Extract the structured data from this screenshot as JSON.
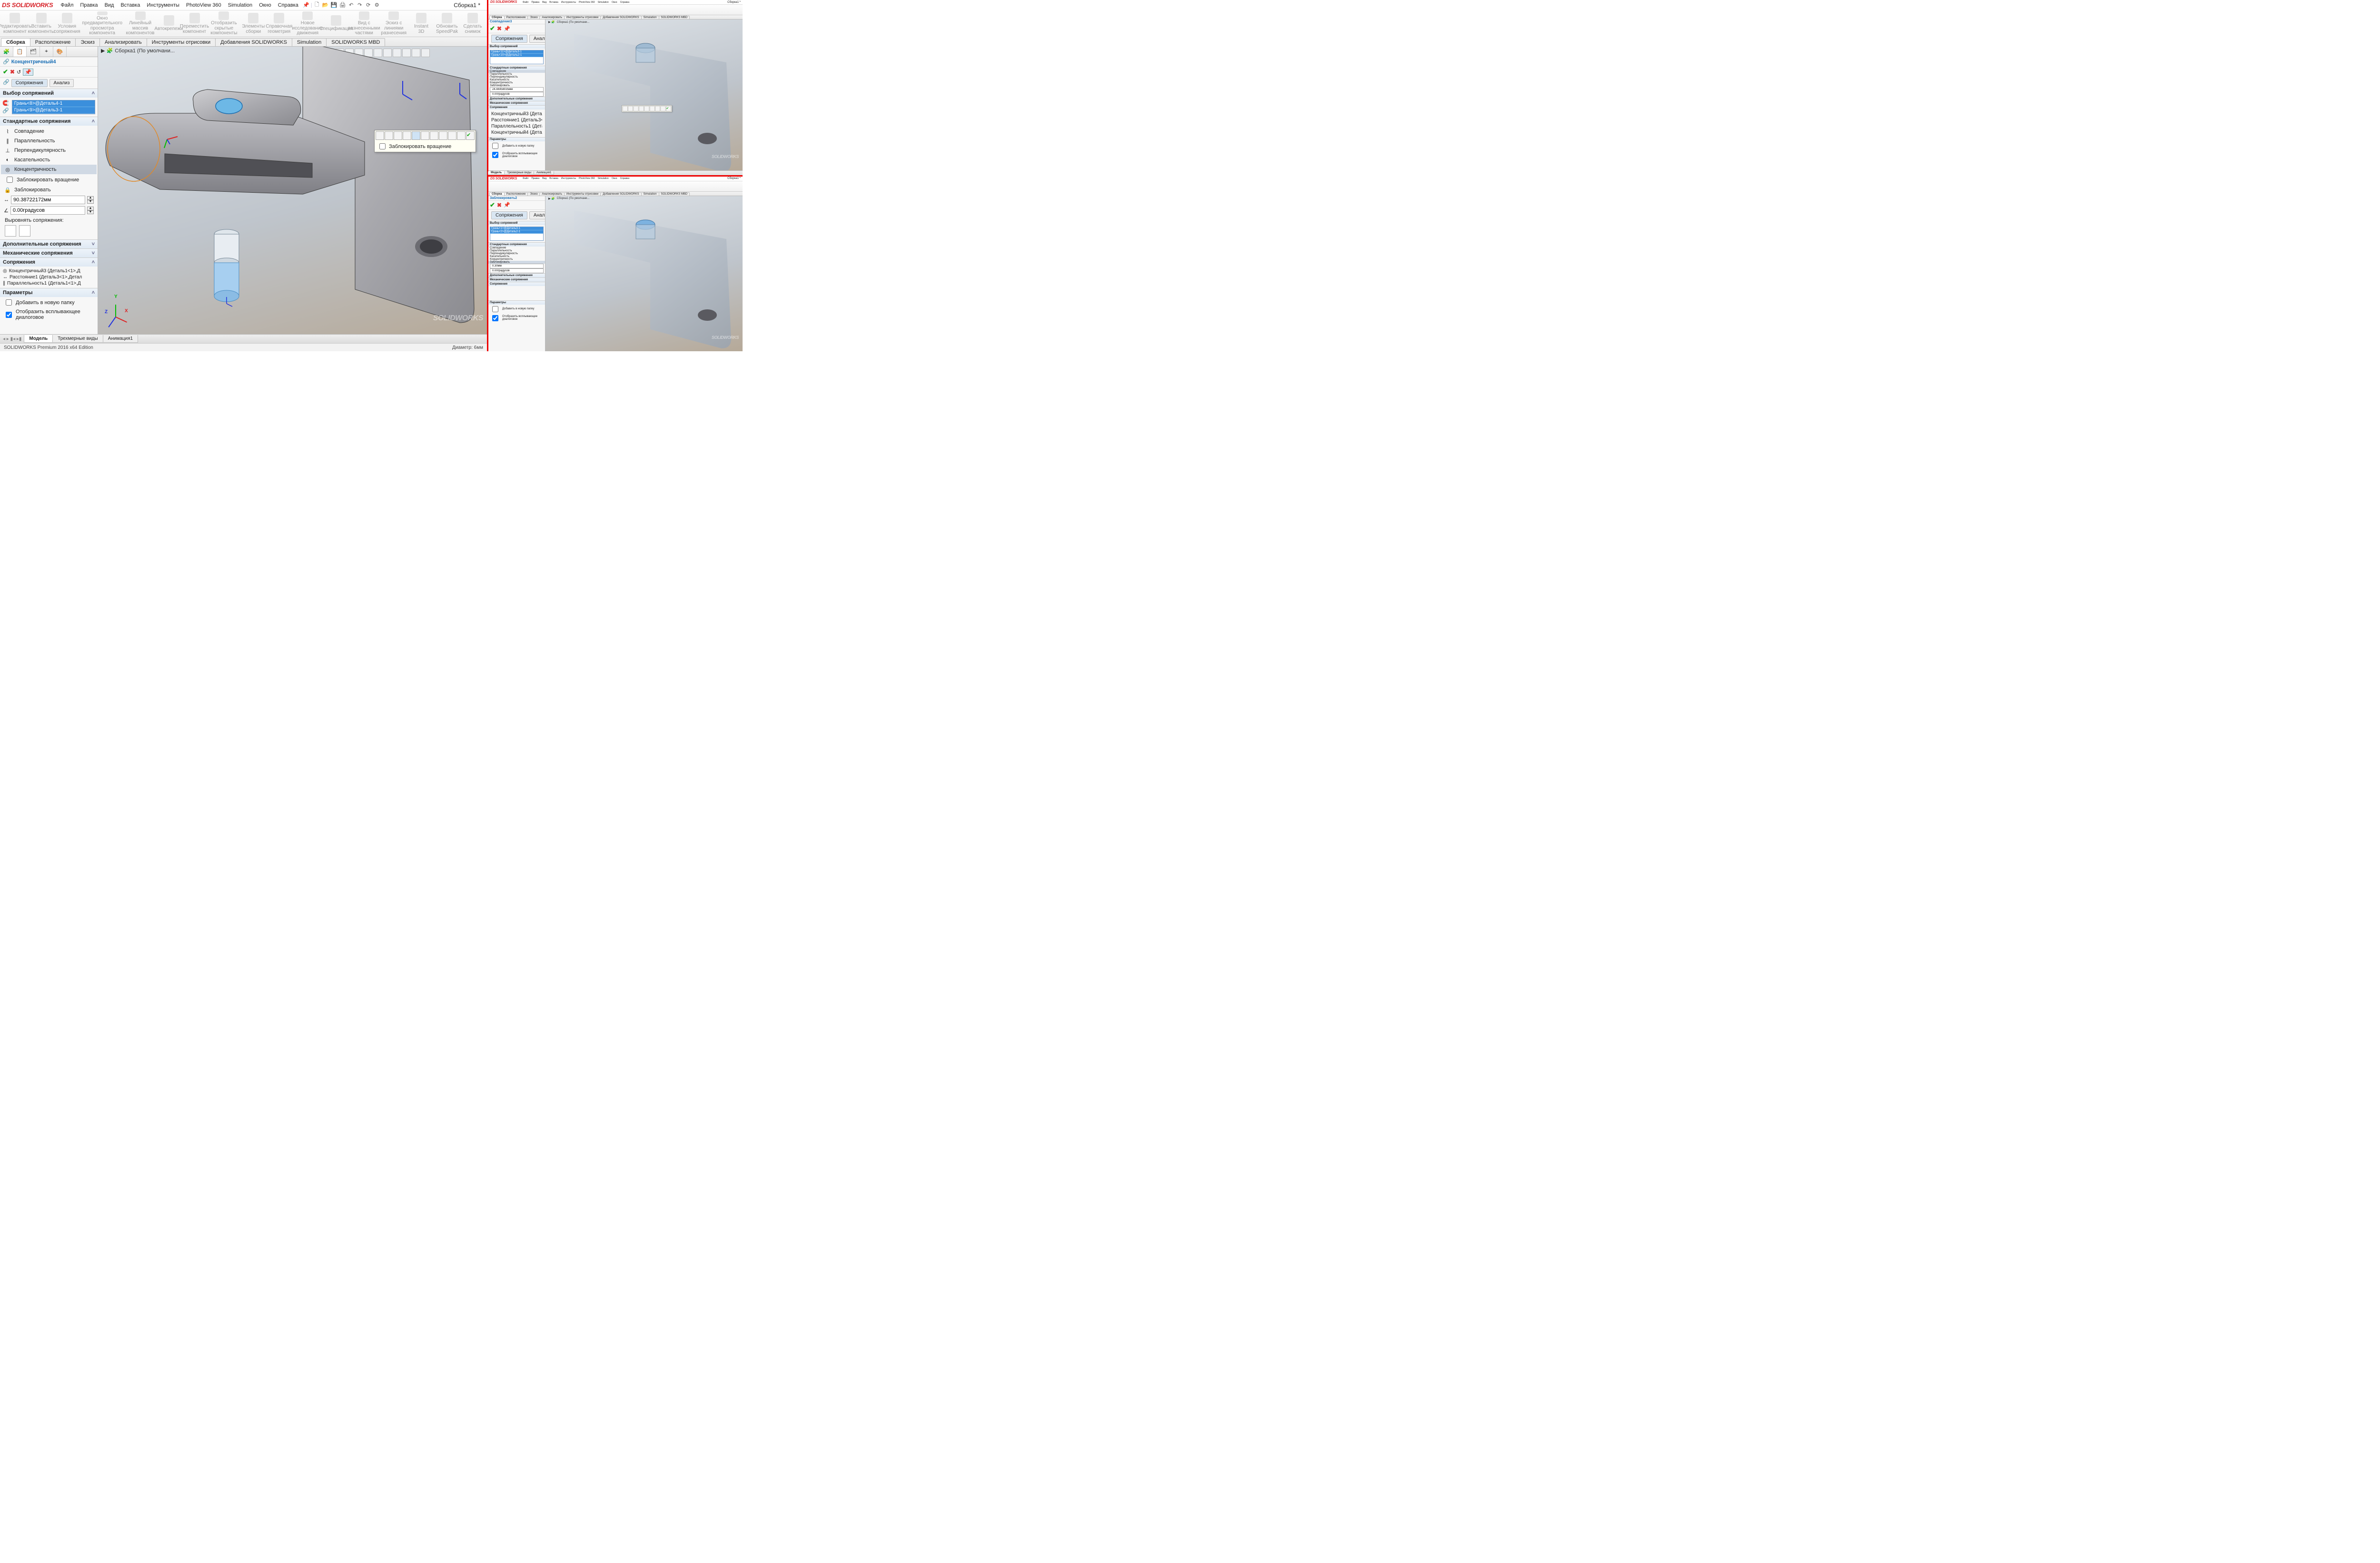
{
  "app": {
    "logo_prefix": "DS",
    "logo_brand": "SOLIDWORKS",
    "document": "Сборка1 *"
  },
  "menu": [
    "Файл",
    "Правка",
    "Вид",
    "Вставка",
    "Инструменты",
    "PhotoView 360",
    "Simulation",
    "Окно",
    "Справка"
  ],
  "ribbon": [
    "Редактировать компонент",
    "Вставить компоненты",
    "Условия сопряжения",
    "Окно предварительного просмотра компонента",
    "Линейный массив компонентов",
    "Автокрепежи",
    "Переместить компонент",
    "Отобразить скрытые компоненты",
    "Элементы сборки",
    "Справочная геометрия",
    "Новое исследование движения",
    "Спецификация",
    "Вид с разнесенными частями",
    "Эскиз с линиями разнесения",
    "Instant 3D",
    "Обновить SpeedPak",
    "Сделать снимок"
  ],
  "tabs": [
    "Сборка",
    "Расположение",
    "Эскиз",
    "Анализировать",
    "Инструменты отрисовки",
    "Добавления SOLIDWORKS",
    "Simulation",
    "SOLIDWORKS MBD"
  ],
  "active_tab": 0,
  "breadcrumb": "Сборка1  (По умолчани...",
  "panel": {
    "title": "Концентричный4",
    "subtabs": [
      "Сопряжения",
      "Анализ"
    ],
    "active_subtab": 0,
    "sections": {
      "selection": "Выбор сопряжений",
      "standard": "Стандартные сопряжения",
      "advanced": "Дополнительные сопряжения",
      "mechanical": "Механические сопряжения",
      "mates": "Сопряжения",
      "options": "Параметры",
      "align": "Выровнять сопряжения:"
    },
    "sel_items": [
      "Грань<8>@Деталь4-1",
      "Грань<9>@Деталь3-1"
    ],
    "std_mates": [
      "Совпадение",
      "Параллельность",
      "Перпендикулярность",
      "Касательность",
      "Концентричность"
    ],
    "selected_std": 4,
    "lock_rotation": "Заблокировать вращение",
    "lock": "Заблокировать",
    "distance": "90.38722172мм",
    "angle": "0.00градусов",
    "mate_items": [
      "Концентричный3 (Деталь1<1>,Д",
      "Расстояние1 (Деталь3<1>,Детал",
      "Параллельность1 (Деталь1<1>,Д"
    ],
    "opt_newfolder": "Добавить в новую папку",
    "opt_popup": "Отобразить всплывающее диалоговое"
  },
  "popup_lock": "Заблокировать вращение",
  "bottom_tabs": [
    "Модель",
    "Трехмерные виды",
    "Анимация1"
  ],
  "active_bottom": 0,
  "status_left": "SOLIDWORKS Premium 2016 x64 Edition",
  "status_right": "Диаметр: 6мм",
  "thumb_top": {
    "title": "Совпадение3",
    "sel": [
      "Грань<11>@Деталь3-1",
      "Грань<10>@Деталь2-1"
    ],
    "distance": "24.44458035мм",
    "angle": "0.00градусов",
    "mates": [
      "Концентричный3 (Деталь1<1>,Дет...",
      "Расстояние1 (Деталь3<1>,Деталь3<...",
      "Параллельность1 (Деталь1<1>,Де...",
      "Концентричный4 (Деталь4<1>,Дет..."
    ],
    "btabs": [
      "Модель",
      "Трехмерные виды",
      "Анимация1"
    ]
  },
  "thumb_bottom": {
    "title": "Заблокировать2",
    "sel": [
      "Грань<1>@Деталь3-1",
      "Грань<2>@Деталь2-1"
    ],
    "distance": "0.30мм",
    "angle": "0.00градусов"
  }
}
